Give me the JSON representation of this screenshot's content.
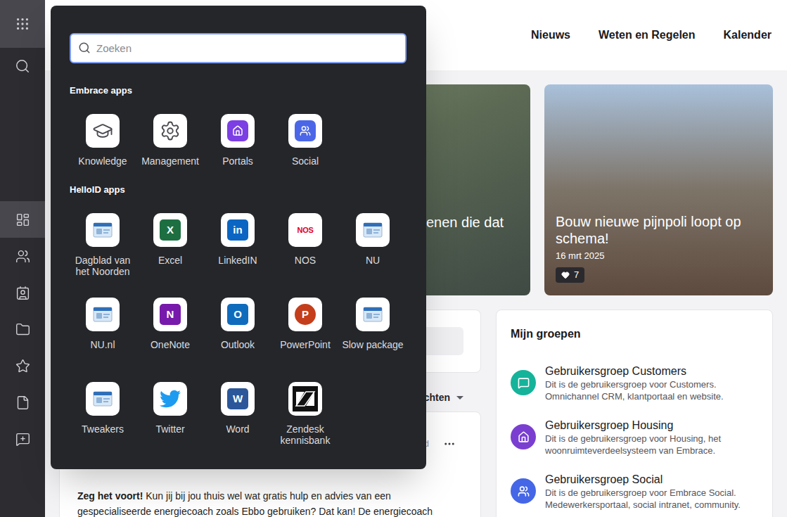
{
  "sidebar": {
    "top": [
      {
        "selected": true
      },
      {
        "selected": false
      }
    ],
    "items": [
      {
        "selected": true
      },
      {
        "selected": false
      },
      {
        "selected": false
      },
      {
        "selected": false
      },
      {
        "selected": false
      },
      {
        "selected": false
      },
      {
        "selected": false
      }
    ]
  },
  "nav": [
    "Nieuws",
    "Weten en Regelen",
    "Kalender"
  ],
  "launcher": {
    "search": {
      "placeholder": "Zoeken"
    },
    "sections": [
      {
        "title": "Embrace apps",
        "apps": [
          {
            "label": "Knowledge"
          },
          {
            "label": "Management"
          },
          {
            "label": "Portals"
          },
          {
            "label": "Social"
          }
        ]
      },
      {
        "title": "HelloID apps",
        "apps": [
          {
            "label": "Dagblad van het Noorden"
          },
          {
            "label": "Excel",
            "glyph": "X"
          },
          {
            "label": "LinkedIN",
            "glyph": "in"
          },
          {
            "label": "NOS",
            "glyph": "NOS"
          },
          {
            "label": "NU"
          },
          {
            "label": "NU.nl"
          },
          {
            "label": "OneNote",
            "glyph": "N"
          },
          {
            "label": "Outlook",
            "glyph": "O"
          },
          {
            "label": "PowerPoint",
            "glyph": "P"
          },
          {
            "label": "Slow package"
          },
          {
            "label": "Tweakers"
          },
          {
            "label": "Twitter"
          },
          {
            "label": "Word",
            "glyph": "W"
          },
          {
            "label": "Zendesk kennisbank"
          }
        ]
      }
    ]
  },
  "news": [
    {
      "title": "enen die dat"
    },
    {
      "title": "Bouw nieuwe pijnpoli loopt op schema!",
      "date": "16 mrt 2025",
      "likes": "7"
    }
  ],
  "feed": {
    "sort": "chten",
    "post": {
      "meta": "d",
      "lead": "Zeg het voort!",
      "body": "Kun jij bij jou thuis wel wat gratis hulp en advies van een gespecialiseerde energiecoach zoals Ebbo gebruiken? Dat kan! De energiecoach"
    }
  },
  "groups": {
    "title": "Mijn groepen",
    "items": [
      {
        "name": "Gebruikersgroep Customers",
        "description": "Dit is de gebruikersgroep voor Customers. Omnichannel CRM, klantportaal en website.",
        "color": "#15b39a"
      },
      {
        "name": "Gebruikersgroep Housing",
        "description": "Dit is de gebruikersgroep voor Housing, het woonruimteverdeelsysteem van Embrace.",
        "color": "#7a3fd0"
      },
      {
        "name": "Gebruikersgroep Social",
        "description": "Dit is de gebruikersgroep voor Embrace Social. Medewerkersportaal, social intranet, community.",
        "color": "#4566e6"
      }
    ]
  }
}
